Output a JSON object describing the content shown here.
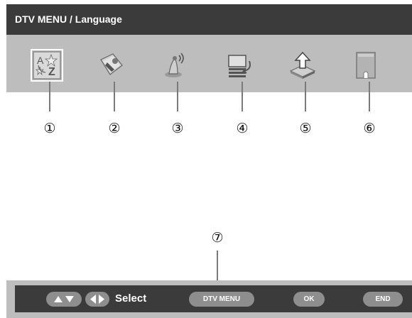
{
  "menu": {
    "title": "DTV MENU / Language",
    "icons": [
      {
        "name": "language-az-icon",
        "selected": true
      },
      {
        "name": "setup-tools-icon"
      },
      {
        "name": "antenna-signal-icon"
      },
      {
        "name": "screen-settings-icon"
      },
      {
        "name": "software-upgrade-icon"
      },
      {
        "name": "card-slot-icon"
      }
    ]
  },
  "callouts": [
    "①",
    "②",
    "③",
    "④",
    "⑤",
    "⑥",
    "⑦"
  ],
  "guide": {
    "select_label": "Select",
    "dtv_menu_label": "DTV MENU",
    "ok_label": "OK",
    "end_label": "END",
    "up_down_icon": "up-down-arrows-icon",
    "left_right_icon": "left-right-arrows-icon"
  },
  "colors": {
    "title_bar": "#3b3b3b",
    "frame": "#bdbdbd",
    "pill": "#8e8e8e",
    "text_light": "#ffffff"
  }
}
